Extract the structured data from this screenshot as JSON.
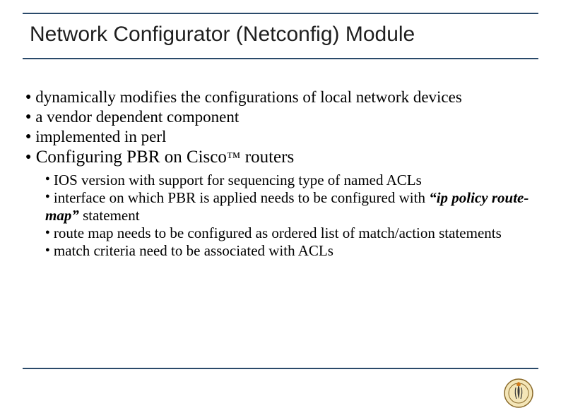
{
  "title": "Network Configurator (Netconfig)  Module",
  "bullets": {
    "b0": "dynamically modifies the configurations of local network devices",
    "b1": "a vendor dependent component",
    "b2": "implemented in perl"
  },
  "section": {
    "prefix": "Configuring PBR on  Cisco",
    "tm": "™",
    "suffix": " routers"
  },
  "sub": {
    "s0": "IOS version with support for sequencing type of named ACLs",
    "s1_a": "interface on which PBR is applied needs to be configured with ",
    "s1_b": "“ip policy route-map”",
    "s1_c": " statement",
    "s2": "route map needs to be configured as ordered  list of match/action statements",
    "s3": "match criteria need to be associated with ACLs"
  },
  "glyphs": {
    "dot": "●"
  }
}
